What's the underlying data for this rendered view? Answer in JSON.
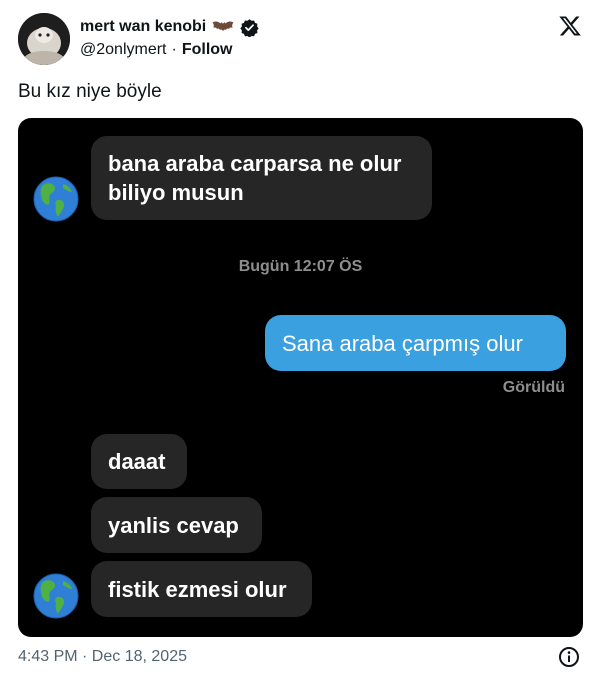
{
  "author": {
    "display_name": "mert wan kenobi",
    "handle": "@2onlymert",
    "follow_label": "Follow",
    "separator": "·"
  },
  "tweet": {
    "text": "Bu kız niye böyle",
    "timestamp": "4:43 PM · Dec 18, 2025"
  },
  "chat": {
    "messages": [
      {
        "side": "incoming",
        "text": "bana araba carparsa ne olur biliyo musun"
      },
      {
        "side": "outgoing",
        "text": "Sana araba çarpmış olur"
      },
      {
        "side": "incoming",
        "text": "daaat"
      },
      {
        "side": "incoming",
        "text": "yanlis cevap"
      },
      {
        "side": "incoming",
        "text": "fistik ezmesi olur"
      }
    ],
    "time_divider": "Bugün 12:07 ÖS",
    "seen_label": "Görüldü",
    "colors": {
      "background": "#000000",
      "incoming_bubble": "#262626",
      "outgoing_bubble": "#3ba0e0",
      "meta_text": "#8e8e8e"
    }
  },
  "icons": {
    "verified": "verified-badge-icon",
    "bat": "bat-emoji-icon",
    "brand": "x-logo-icon",
    "avatar": "globe-earth-americas-icon",
    "info": "info-icon"
  }
}
